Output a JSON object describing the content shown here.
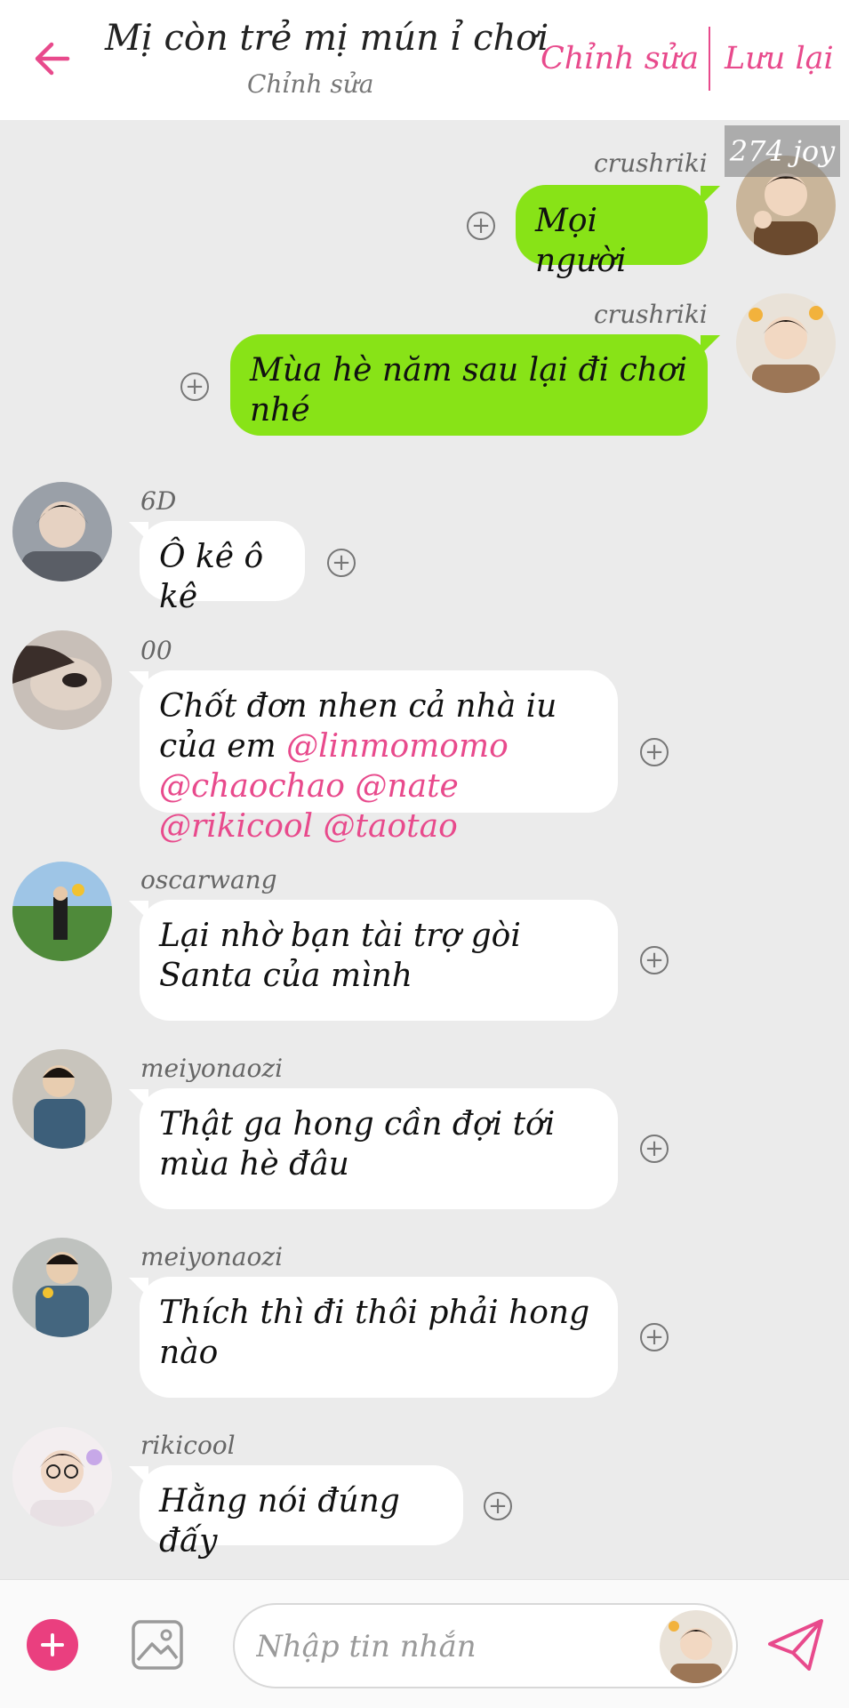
{
  "header": {
    "title": "Mị còn trẻ mị mún ỉ chơi",
    "subtitle": "Chỉnh sửa",
    "edit_label": "Chỉnh sửa",
    "save_label": "Lưu lại"
  },
  "sticker_label": "274 joy",
  "messages": [
    {
      "sender": "crushriki",
      "text": "Mọi người"
    },
    {
      "sender": "crushriki",
      "text": "Mùa hè năm sau lại đi chơi nhé"
    },
    {
      "sender": "6D",
      "text": "Ô kê ô kê"
    },
    {
      "sender": "00",
      "text_parts": [
        "Chốt đơn nhen cả nhà iu của em ",
        "@linmomomo",
        " ",
        "@chaochao",
        " ",
        "@nate",
        " ",
        "@rikicool",
        " ",
        "@taotao"
      ]
    },
    {
      "sender": "oscarwang",
      "text": "Lại nhờ bạn tài trợ gòi Santa của mình"
    },
    {
      "sender": "meiyonaozi",
      "text": "Thật ga hong cần đợi tới mùa hè đâu"
    },
    {
      "sender": "meiyonaozi",
      "text": "Thích thì đi thôi phải hong nào"
    },
    {
      "sender": "rikicool",
      "text": "Hằng nói đúng đấy"
    }
  ],
  "input": {
    "placeholder": "Nhập tin nhắn"
  },
  "colors": {
    "accent": "#e84a8c",
    "outgoing_bubble": "#88e317",
    "incoming_bubble": "#ffffff",
    "background": "#ebebeb"
  }
}
